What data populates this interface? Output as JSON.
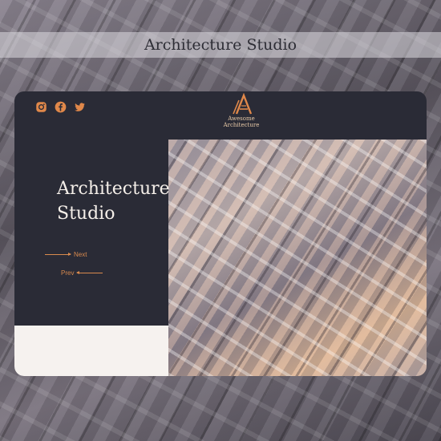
{
  "banner": {
    "title": "Architecture Studio"
  },
  "social": {
    "icons": [
      "instagram-icon",
      "facebook-icon",
      "twitter-icon"
    ]
  },
  "logo": {
    "line1": "Awesome",
    "line2": "Architecture"
  },
  "hero": {
    "heading_line1": "Architecture",
    "heading_line2": "Studio",
    "next_label": "Next",
    "prev_label": "Prev"
  },
  "colors": {
    "accent": "#d98a4e",
    "card_bg": "#2a2b36",
    "light_panel": "#f6f2ef",
    "heading_text": "#f5efe9"
  }
}
